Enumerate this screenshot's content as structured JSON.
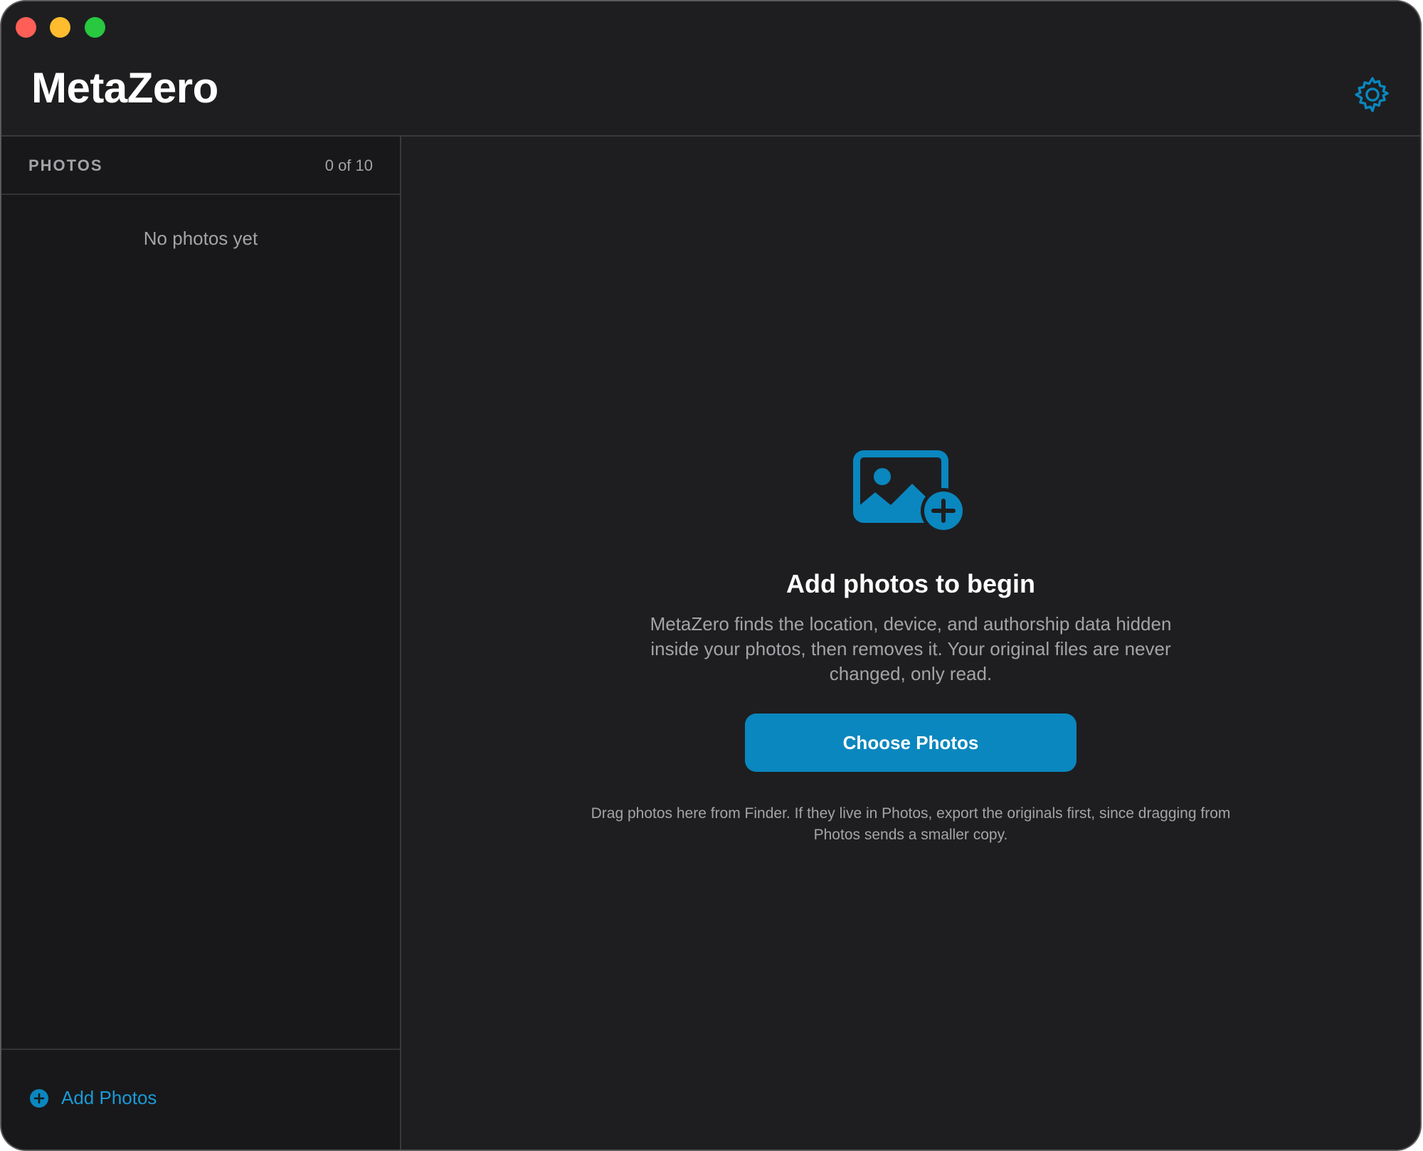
{
  "app": {
    "title": "MetaZero",
    "accent_color": "#0a87bf"
  },
  "window_controls": {
    "close_color": "#ff5f57",
    "minimize_color": "#febc2e",
    "zoom_color": "#28c840"
  },
  "header": {
    "settings_icon": "gear-icon"
  },
  "sidebar": {
    "title": "PHOTOS",
    "count": "0 of 10",
    "empty_label": "No photos yet",
    "add_button": {
      "label": "Add Photos",
      "icon": "plus-circle-icon"
    }
  },
  "main": {
    "icon": "photo-add-icon",
    "title": "Add photos to begin",
    "description": "MetaZero finds the location, device, and authorship data hidden inside your photos, then removes it. Your original files are never changed, only read.",
    "choose_button_label": "Choose Photos",
    "hint": "Drag photos here from Finder. If they live in Photos, export the originals first, since dragging from Photos sends a smaller copy."
  }
}
